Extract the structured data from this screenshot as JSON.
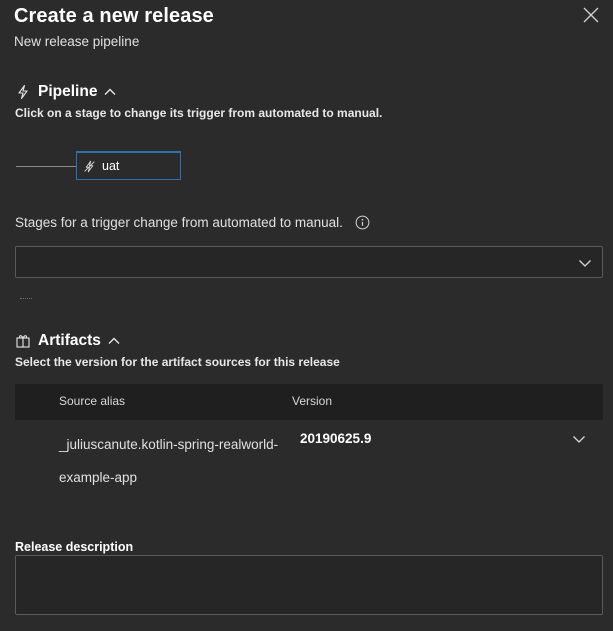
{
  "dialog": {
    "title": "Create a new release",
    "subtitle": "New release pipeline"
  },
  "pipeline": {
    "heading": "Pipeline",
    "description": "Click on a stage to change its trigger from automated to manual.",
    "stages": [
      {
        "name": "uat"
      }
    ]
  },
  "trigger_change": {
    "label": "Stages for a trigger change from automated to manual.",
    "selected_value": ""
  },
  "artifacts": {
    "heading": "Artifacts",
    "description": "Select the version for the artifact sources for this release",
    "columns": {
      "alias": "Source alias",
      "version": "Version"
    },
    "rows": [
      {
        "alias": "_juliuscanute.kotlin-spring-realworld-example-app",
        "version": "20190625.9"
      }
    ]
  },
  "release_description": {
    "label": "Release description",
    "value": ""
  },
  "icons": {
    "close": "close-icon",
    "pipeline": "lightning-icon",
    "artifacts": "package-icon",
    "info": "info-icon",
    "chevron_up": "chevron-up-icon",
    "chevron_down": "chevron-down-icon"
  },
  "colors": {
    "background": "#2b2b2b",
    "accent": "#2f6fb3"
  }
}
